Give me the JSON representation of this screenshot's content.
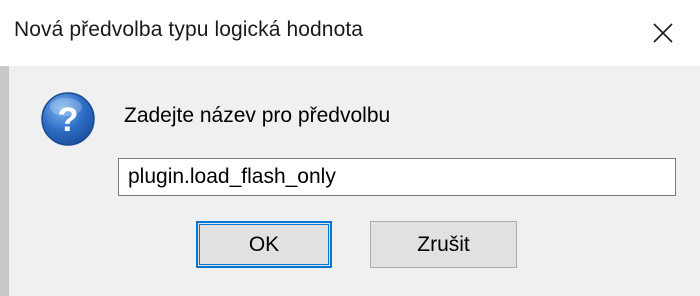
{
  "window": {
    "title": "Nová předvolba typu logická hodnota",
    "close_icon": "close-icon"
  },
  "dialog": {
    "icon": "question-icon",
    "prompt": "Zadejte název pro předvolbu",
    "input_value": "plugin.load_flash_only"
  },
  "buttons": {
    "ok_label": "OK",
    "cancel_label": "Zrušit"
  },
  "colors": {
    "focus_accent": "#0078d7",
    "icon_blue": "#1f5fb4",
    "client_background": "#f0f0f0",
    "button_background": "#e1e1e1"
  }
}
